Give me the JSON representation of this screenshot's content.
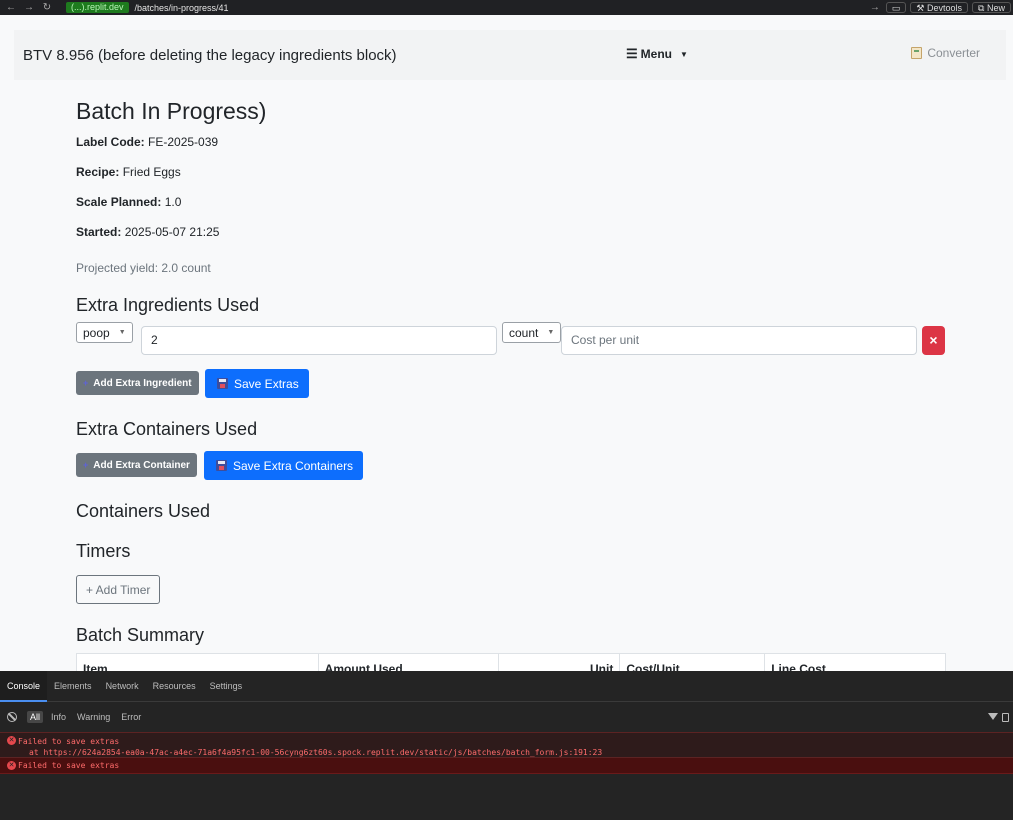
{
  "browser": {
    "domain": "(...).replit.dev",
    "path": "/batches/in-progress/41",
    "devtools_label": "Devtools",
    "new_label": "New"
  },
  "navbar": {
    "brand": "BTV 8.956 (before deleting the legacy ingredients block)",
    "menu_label": "Menu",
    "converter_label": "Converter"
  },
  "page": {
    "title": "Batch In Progress)",
    "fields": [
      {
        "label": "Label Code:",
        "value": "FE-2025-039"
      },
      {
        "label": "Recipe:",
        "value": "Fried Eggs"
      },
      {
        "label": "Scale Planned:",
        "value": "1.0"
      },
      {
        "label": "Started:",
        "value": "2025-05-07 21:25"
      }
    ],
    "projected_yield": "Projected yield: 2.0 count"
  },
  "extra_ingredients": {
    "heading": "Extra Ingredients Used",
    "row": {
      "ingredient": "poop",
      "quantity": "2",
      "unit": "count",
      "cost_placeholder": "Cost per unit",
      "delete_label": "×"
    },
    "add_label": "Add Extra Ingredient",
    "save_label": "Save Extras"
  },
  "extra_containers": {
    "heading": "Extra Containers Used",
    "add_label": "Add Extra Container",
    "save_label": "Save Extra Containers"
  },
  "containers": {
    "heading": "Containers Used"
  },
  "timers": {
    "heading": "Timers",
    "add_label": "+ Add Timer"
  },
  "summary": {
    "heading": "Batch Summary",
    "columns": [
      "Item",
      "Amount Used",
      "Unit",
      "Cost/Unit",
      "Line Cost"
    ]
  },
  "devtools": {
    "tabs": [
      "Console",
      "Elements",
      "Network",
      "Resources",
      "Settings"
    ],
    "levels": [
      "All",
      "Info",
      "Warning",
      "Error"
    ],
    "logs": [
      {
        "message": "Failed to save extras",
        "trace": "at https://624a2854-ea0a-47ac-a4ec-71a6f4a95fc1-00-56cyng6zt60s.spock.replit.dev/static/js/batches/batch_form.js:191:23"
      },
      {
        "message": "Failed to save extras"
      }
    ]
  }
}
